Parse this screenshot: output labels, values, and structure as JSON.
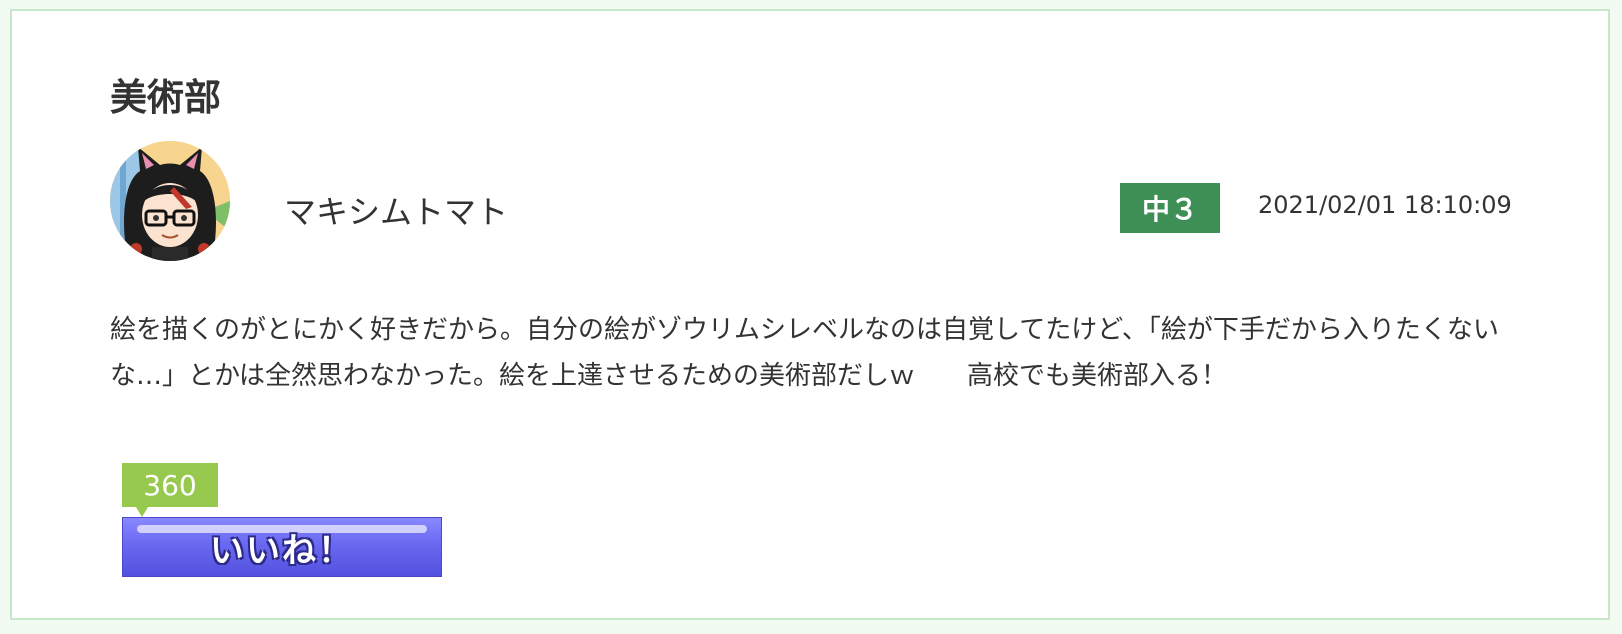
{
  "post": {
    "title": "美術部",
    "author": {
      "name": "マキシムトマト",
      "avatar_icon": "cat-ear-girl-avatar-icon"
    },
    "grade": "中３",
    "timestamp": "2021/02/01 18:10:09",
    "body": "絵を描くのがとにかく好きだから。自分の絵がゾウリムシレベルなのは自覚してたけど、「絵が下手だから入りたくないな…」とかは全然思わなかった。絵を上達させるための美術部だしｗ　　高校でも美術部入る！",
    "like_count": "360",
    "like_label": "いいね！"
  },
  "colors": {
    "page_background": "#f2fbf2",
    "card_border": "#c8e6c8",
    "grade_badge": "#3d8f55",
    "like_count_badge": "#96c94e",
    "like_button": "#6a68f0"
  }
}
